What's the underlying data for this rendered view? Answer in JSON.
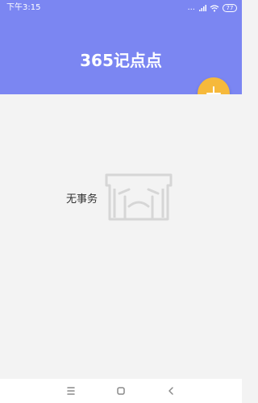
{
  "status_bar": {
    "time": "下午3:15",
    "dots": "...",
    "battery_level": "77"
  },
  "header": {
    "title": "365记点点",
    "background_color": "#7b86f2"
  },
  "fab": {
    "icon": "plus-icon",
    "color": "#f6b93b"
  },
  "empty_state": {
    "text": "无事务",
    "icon": "crying-face-icon"
  },
  "nav_bar": {
    "buttons": [
      "menu-icon",
      "home-icon",
      "back-icon"
    ]
  }
}
